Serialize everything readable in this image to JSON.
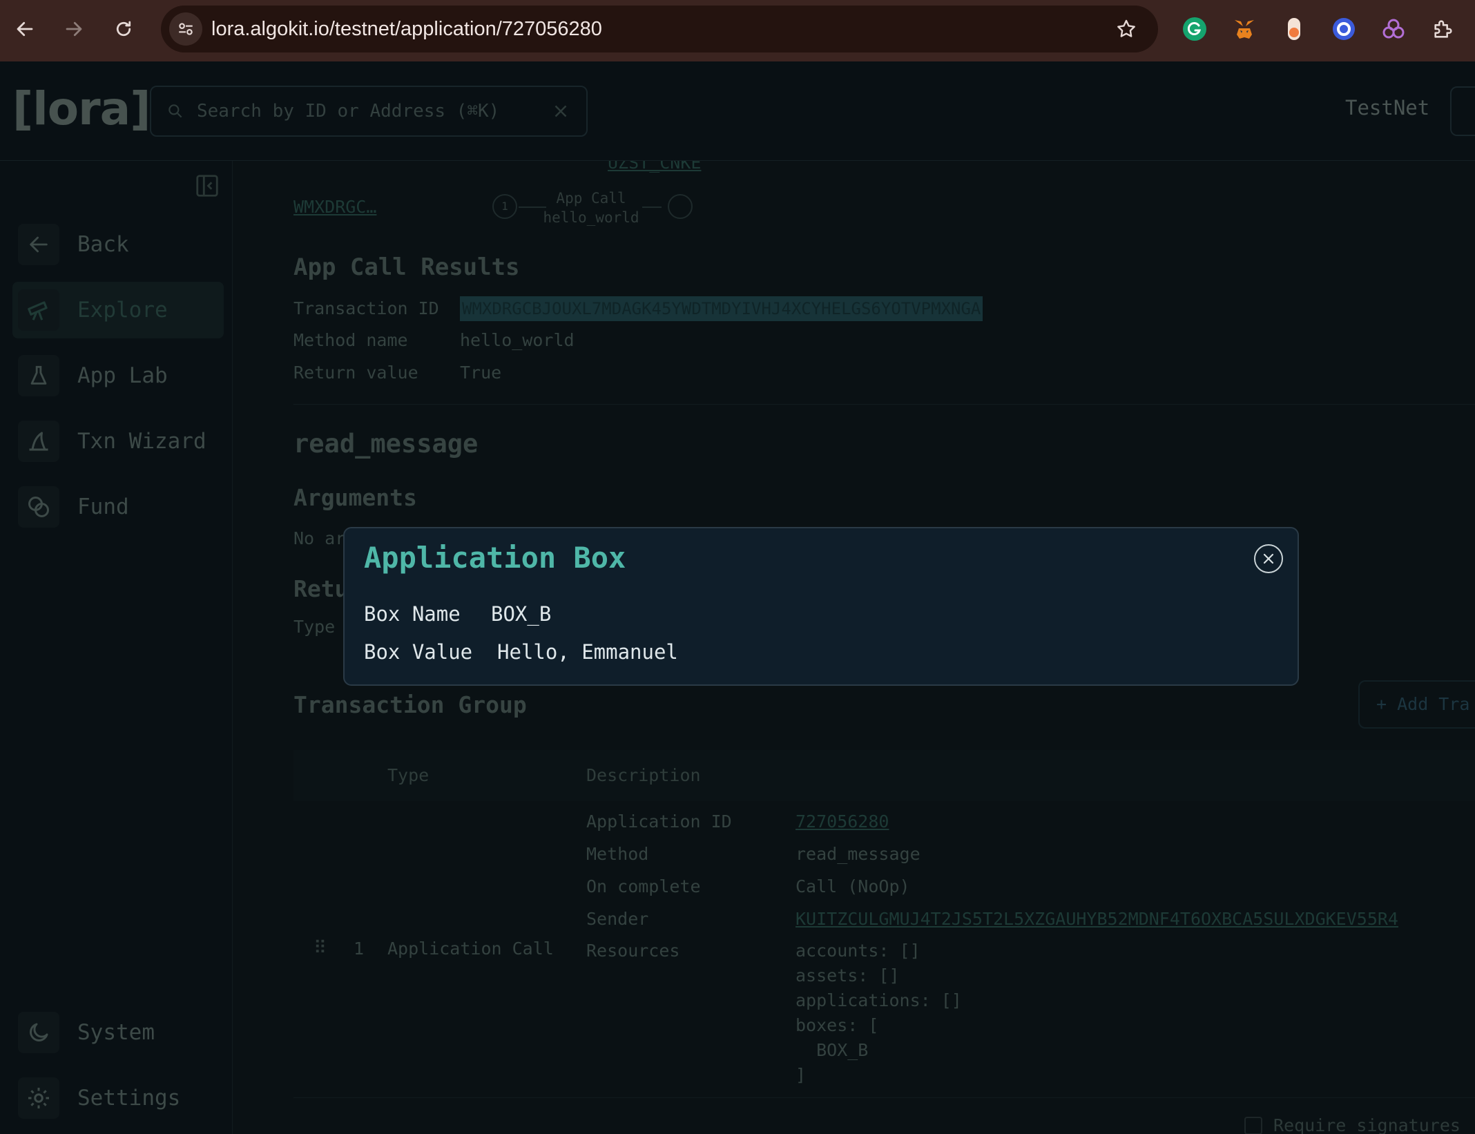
{
  "browser": {
    "url": "lora.algokit.io/testnet/application/727056280"
  },
  "header": {
    "logo": "[lora]",
    "search_placeholder": "Search by ID or Address (⌘K)",
    "network": "TestNet"
  },
  "sidebar": {
    "items": [
      {
        "label": "Back",
        "icon": "arrow-left-icon"
      },
      {
        "label": "Explore",
        "icon": "telescope-icon",
        "active": true
      },
      {
        "label": "App Lab",
        "icon": "flask-icon"
      },
      {
        "label": "Txn Wizard",
        "icon": "wizard-hat-icon"
      },
      {
        "label": "Fund",
        "icon": "coins-icon"
      }
    ],
    "bottom": [
      {
        "label": "System",
        "icon": "moon-icon"
      },
      {
        "label": "Settings",
        "icon": "gear-icon"
      }
    ]
  },
  "main": {
    "top_link": "UZST_CNKE",
    "graph": {
      "sender": "WMXDRGC…",
      "node_index": "1",
      "edge_label_1": "App Call",
      "edge_label_2": "hello_world"
    },
    "results": {
      "title": "App Call Results",
      "rows": [
        {
          "label": "Transaction ID",
          "value": "WMXDRGCBJOUXL7MDAGK45YWDTMDYIVHJ4XCYHELGS6YOTVPMXNGA"
        },
        {
          "label": "Method name",
          "value": "hello_world"
        },
        {
          "label": "Return value",
          "value": "True"
        }
      ]
    },
    "method": {
      "name": "read_message",
      "arguments_title": "Arguments",
      "arguments_text": "No ar",
      "returns_title": "Retu",
      "returns_text": "Type"
    },
    "group": {
      "title": "Transaction Group",
      "add_button": "+ Add Tra",
      "columns": [
        "Type",
        "Description"
      ],
      "row": {
        "index": "1",
        "type": "Application Call",
        "details": [
          {
            "label": "Application ID",
            "value": "727056280"
          },
          {
            "label": "Method",
            "value": "read_message"
          },
          {
            "label": "On complete",
            "value": "Call (NoOp)"
          },
          {
            "label": "Sender",
            "value": "KUITZCULGMUJ4T2JS5T2L5XZGAUHYB52MDNF4T6OXBCA5SULXDGKEV55R4"
          },
          {
            "label": "Resources",
            "value": ""
          }
        ],
        "resources": [
          "accounts: []",
          "assets: []",
          "applications: []",
          "boxes: [",
          "  BOX_B",
          "]"
        ]
      }
    },
    "require_signatures": "Require signatures"
  },
  "modal": {
    "title": "Application Box",
    "box_name_label": "Box Name",
    "box_name": "BOX_B",
    "box_value_label": "Box Value",
    "box_value": "Hello, Emmanuel"
  }
}
